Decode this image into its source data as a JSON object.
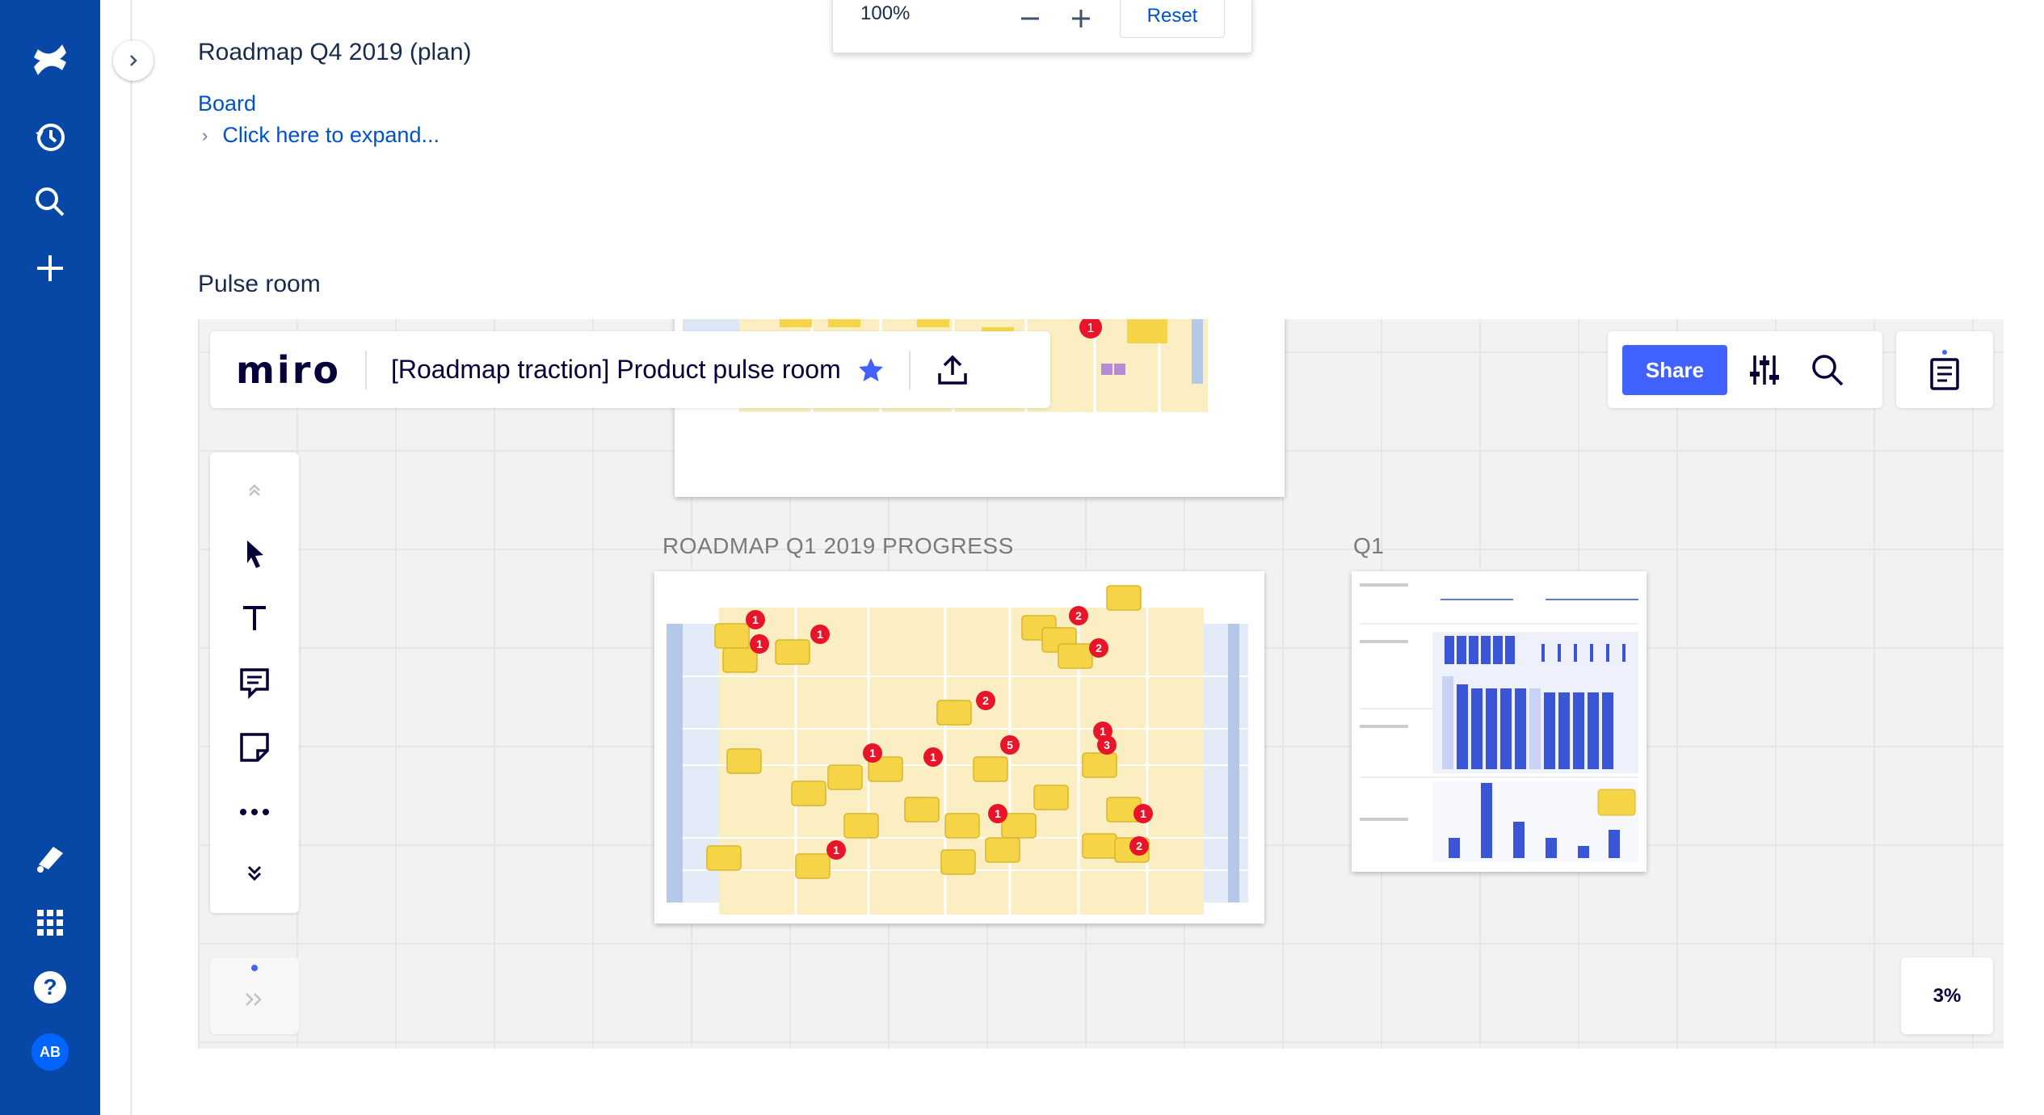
{
  "page": {
    "title": "Roadmap Q4 2019 (plan)",
    "board_link": "Board",
    "expand_link": "Click here to expand...",
    "section_title": "Pulse room"
  },
  "nav": {
    "icons": [
      "confluence-logo-icon",
      "recent-icon",
      "search-icon",
      "create-icon",
      "feedback-icon",
      "app-switcher-icon",
      "help-icon"
    ],
    "avatar_initials": "AB"
  },
  "zoom_popup": {
    "value": "100%",
    "reset_label": "Reset"
  },
  "miro": {
    "logo": "miro",
    "board_title": "[Roadmap traction] Product pulse room",
    "share_label": "Share",
    "zoom_level": "3%",
    "frame_labels": [
      "ROADMAP Q1 2019 PROGRESS",
      "Q1"
    ],
    "tools": [
      "select-tool",
      "text-tool",
      "comment-tool",
      "sticky-note-tool",
      "more-tools",
      "expand-tools"
    ]
  },
  "colors": {
    "nav_bg": "#0747a6",
    "link": "#0052cc",
    "miro_accent": "#4262ff",
    "sticky_yellow": "#f5d547",
    "badge_red": "#e8142a"
  }
}
